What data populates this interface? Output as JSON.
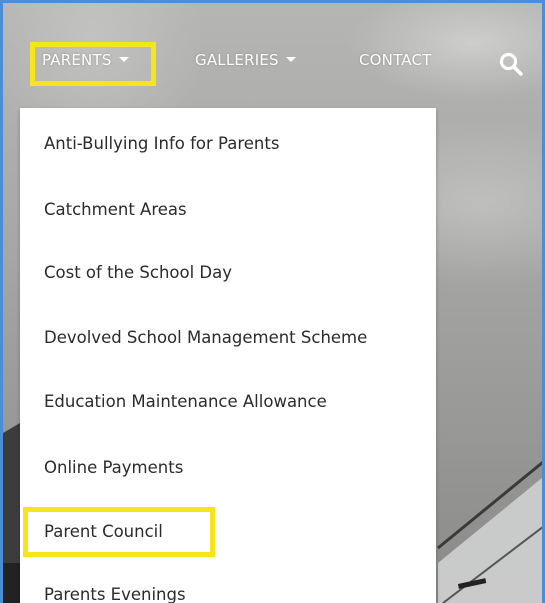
{
  "nav": {
    "items": [
      {
        "label": "PARENTS",
        "has_caret": true
      },
      {
        "label": "GALLERIES",
        "has_caret": true
      },
      {
        "label": "CONTACT",
        "has_caret": false
      }
    ],
    "search_icon": "search-icon"
  },
  "dropdown": {
    "items": [
      {
        "label": "Anti-Bullying Info for Parents"
      },
      {
        "label": "Catchment Areas"
      },
      {
        "label": "Cost of the School Day"
      },
      {
        "label": "Devolved School Management Scheme"
      },
      {
        "label": "Education Maintenance Allowance"
      },
      {
        "label": "Online Payments"
      },
      {
        "label": "Parent Council"
      },
      {
        "label": "Parents Evenings"
      }
    ]
  },
  "highlights": {
    "color": "#f5e61c"
  },
  "colors": {
    "frame_border": "#4a8fd6",
    "nav_text": "#ffffff",
    "dropdown_bg": "#ffffff",
    "dropdown_text": "#2b2b2b"
  }
}
